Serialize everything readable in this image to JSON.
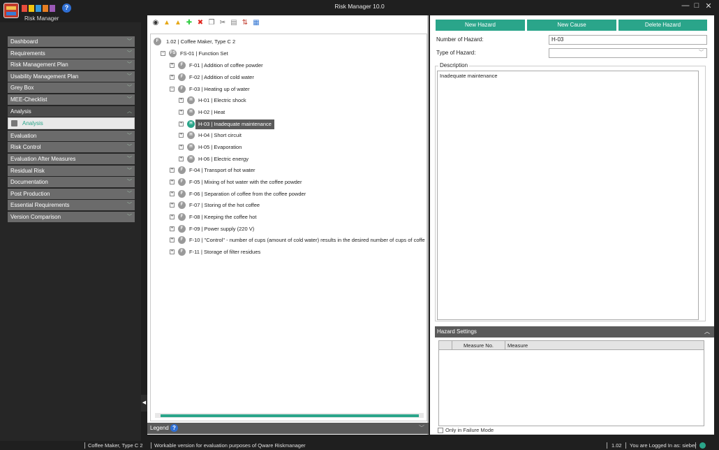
{
  "app": {
    "title": "Risk Manager  10.0",
    "logo_label": "Risk Manager",
    "help_glyph": "?",
    "window_controls": {
      "minimize": "—",
      "maximize": "□",
      "close": "✕"
    }
  },
  "sidebar": {
    "items": [
      {
        "label": "Dashboard"
      },
      {
        "label": "Requirements"
      },
      {
        "label": "Risk Management Plan"
      },
      {
        "label": "Usability Management Plan"
      },
      {
        "label": "Grey Box"
      },
      {
        "label": "MEE-Checklist"
      },
      {
        "label": "Analysis"
      },
      {
        "label": "Evaluation"
      },
      {
        "label": "Risk Control"
      },
      {
        "label": "Evaluation After Measures"
      },
      {
        "label": "Residual Risk"
      },
      {
        "label": "Documentation"
      },
      {
        "label": "Post Production"
      },
      {
        "label": "Essential Requirements"
      },
      {
        "label": "Version Comparison"
      }
    ],
    "open_item": "Analysis",
    "sub_item": "Analysis",
    "chevron_down": "﹀",
    "chevron_up": "︿"
  },
  "tree": {
    "root": {
      "badge": "F",
      "text": "1.02  |  Coffee Maker, Type C 2"
    },
    "function_set": {
      "badge": "FS",
      "text": "FS-01  |  Function Set",
      "expander": "⊟"
    },
    "functions": [
      {
        "badge": "F",
        "text": "F-01  |  Addition of coffee powder",
        "expander": "⊞"
      },
      {
        "badge": "F",
        "text": "F-02  |  Addition of cold water",
        "expander": "⊞"
      },
      {
        "badge": "F",
        "text": "F-03  |  Heating up of water",
        "expander": "⊟"
      },
      {
        "badge": "F",
        "text": "F-04  |  Transport of hot water",
        "expander": "⊞"
      },
      {
        "badge": "F",
        "text": "F-05  |  Mixing of hot water with the coffee powder",
        "expander": "⊞"
      },
      {
        "badge": "F",
        "text": "F-06  |  Separation of coffee from the coffee powder",
        "expander": "⊞"
      },
      {
        "badge": "F",
        "text": "F-07  |  Storing of the hot coffee",
        "expander": "⊞"
      },
      {
        "badge": "F",
        "text": "F-08  |  Keeping the coffee hot",
        "expander": "⊞"
      },
      {
        "badge": "F",
        "text": "F-09  |  Power supply (220 V)",
        "expander": "⊞"
      },
      {
        "badge": "F",
        "text": "F-10  |  \"Control\" - number of cups (amount of cold water) results in the desired number of cups of coffe",
        "expander": "⊞"
      },
      {
        "badge": "F",
        "text": "F-11  |  Storage of filter residues",
        "expander": "⊞"
      }
    ],
    "hazards": [
      {
        "badge": "H",
        "text": "H-01  |  Electric shock",
        "expander": "⊞"
      },
      {
        "badge": "H",
        "text": "H-02  |  Heat",
        "expander": "⊞"
      },
      {
        "badge": "H",
        "text": "H-03  |  Inadequate maintenance",
        "expander": "⊞",
        "selected": true
      },
      {
        "badge": "H",
        "text": "H-04  |  Short circuit",
        "expander": "⊞"
      },
      {
        "badge": "H",
        "text": "H-05  |  Evaporation",
        "expander": "⊞"
      },
      {
        "badge": "H",
        "text": "H-06  |  Electric energy",
        "expander": "⊞"
      }
    ],
    "root_expander": ""
  },
  "legend": {
    "label": "Legend",
    "chevron": "﹀"
  },
  "right": {
    "buttons": {
      "new_hazard": "New Hazard",
      "new_cause": "New Cause",
      "delete_hazard": "Delete Hazard"
    },
    "number_label": "Number of Hazard:",
    "number_value": "H-03",
    "type_label": "Type of Hazard:",
    "type_value": "",
    "description_label": "Description",
    "description_value": "Inadequate maintenance",
    "hazard_settings": "Hazard Settings",
    "grid_columns": {
      "measure_no": "Measure No.",
      "measure": "Measure"
    },
    "only_failure_mode": "Only in Failure Mode"
  },
  "status": {
    "project": "Coffee Maker, Type C 2",
    "message": "Workable version for evaluation purposes of Qware Riskmanager",
    "version": "1.02",
    "user": "You are Logged In as: sieber"
  },
  "colors": {
    "accent": "#2aa58a",
    "panel_dark": "#1f1f1f",
    "nav_item": "#6b6b6b"
  }
}
